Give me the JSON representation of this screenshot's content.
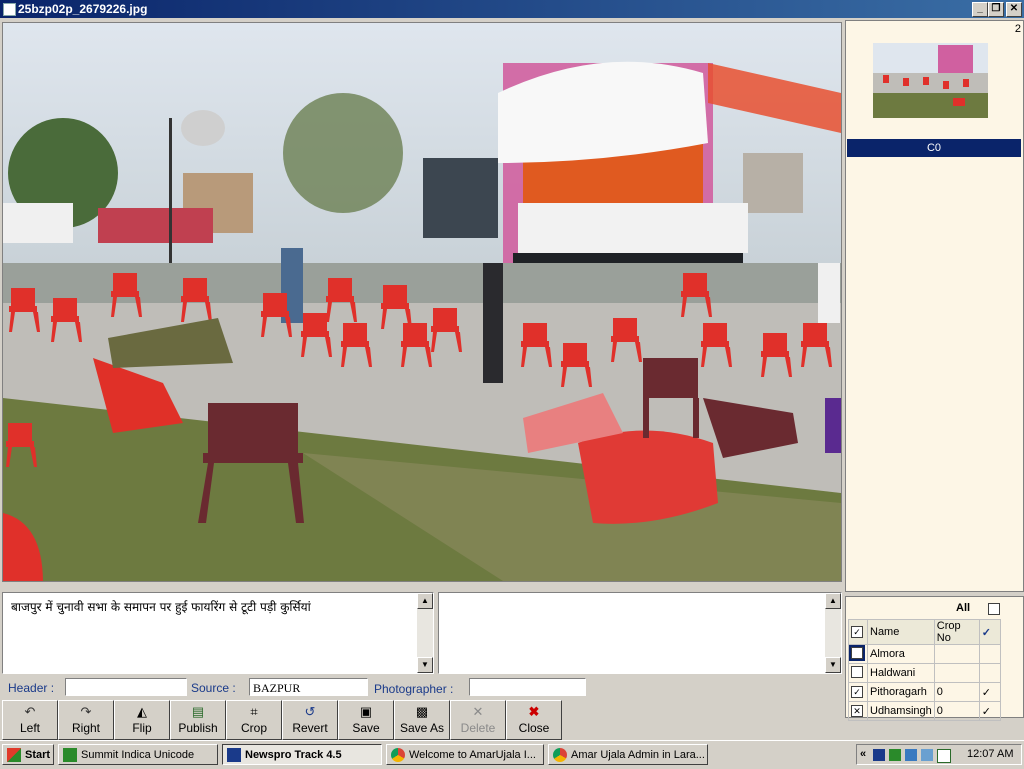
{
  "window": {
    "title": "25bzp02p_2679226.jpg"
  },
  "thumbnail": {
    "count": "2",
    "selected_label": "C0"
  },
  "caption": {
    "hindi_text": "बाजपुर में चुनावी सभा के समापन पर हुई फायरिंग से टूटी पड़ी कुर्सियां",
    "english_text": ""
  },
  "fields": {
    "header_label": "Header :",
    "header_value": "",
    "source_label": "Source :",
    "source_value": "BAZPUR",
    "photographer_label": "Photographer :",
    "photographer_value": ""
  },
  "toolbar": {
    "left": "Left",
    "right": "Right",
    "flip": "Flip",
    "publish": "Publish",
    "crop": "Crop",
    "revert": "Revert",
    "save": "Save",
    "save_as": "Save As",
    "delete": "Delete",
    "close": "Close"
  },
  "district_panel": {
    "all_label": "All",
    "columns": [
      "Name",
      "Crop No"
    ],
    "rows": [
      {
        "name": "Almora",
        "crop": "",
        "checked": false,
        "tick": false
      },
      {
        "name": "Haldwani",
        "crop": "",
        "checked": false,
        "tick": false
      },
      {
        "name": "Pithoragarh",
        "crop": "0",
        "checked": true,
        "tick": true
      },
      {
        "name": "Udhamsingh",
        "crop": "0",
        "checked": true,
        "tick": true
      }
    ]
  },
  "taskbar": {
    "start": "Start",
    "tasks": [
      "Summit Indica Unicode",
      "Newspro Track 4.5",
      "Welcome to AmarUjala I...",
      "Amar Ujala Admin in Lara..."
    ],
    "clock": "12:07 AM"
  },
  "colors": {
    "titlebar": "#0a246a",
    "selection": "#0a246a",
    "panel_bg": "#fdf6e6",
    "chair_red": "#e8302a"
  }
}
